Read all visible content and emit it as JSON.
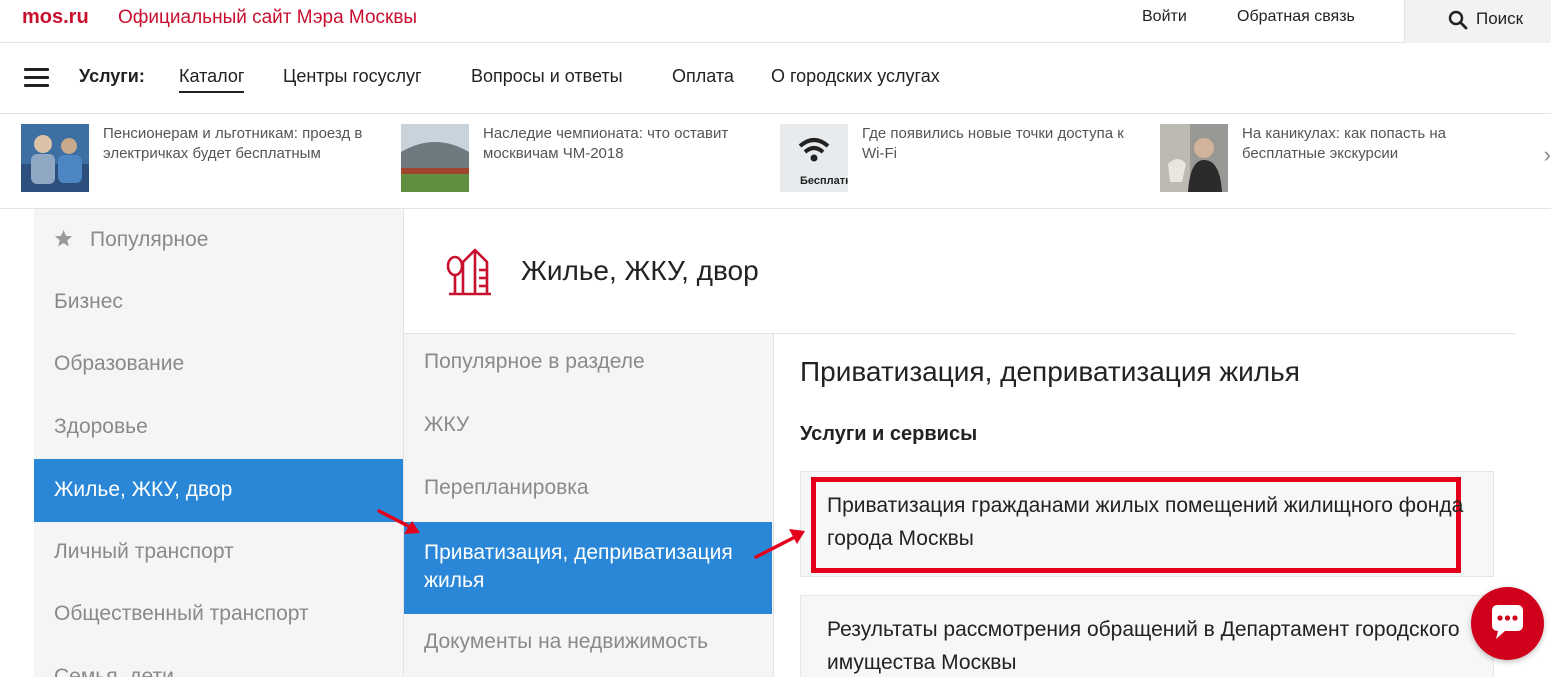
{
  "header": {
    "logo": "mos.ru",
    "site_title": "Официальный сайт Мэра Москвы",
    "login": "Войти",
    "feedback": "Обратная связь",
    "search_label": "Поиск"
  },
  "nav": {
    "label": "Услуги:",
    "items": [
      {
        "label": "Каталог",
        "active": true
      },
      {
        "label": "Центры госуслуг"
      },
      {
        "label": "Вопросы и ответы"
      },
      {
        "label": "Оплата"
      },
      {
        "label": "О городских услугах"
      }
    ]
  },
  "news": [
    {
      "text": "Пенсионерам и льготникам: проезд в электричках будет бесплатным"
    },
    {
      "text": "Наследие чемпионата: что оставит москвичам ЧМ-2018"
    },
    {
      "text": "Где появились новые точки доступа к Wi-Fi",
      "thumb_text": "Бесплатны"
    },
    {
      "text": "На каникулах: как попасть на бесплатные экскурсии"
    }
  ],
  "sidebar": {
    "items": [
      {
        "label": "Популярное",
        "icon": "star-icon"
      },
      {
        "label": "Бизнес"
      },
      {
        "label": "Образование"
      },
      {
        "label": "Здоровье"
      },
      {
        "label": "Жилье, ЖКУ, двор",
        "active": true
      },
      {
        "label": "Личный транспорт"
      },
      {
        "label": "Общественный транспорт"
      },
      {
        "label": "Семья, дети"
      }
    ]
  },
  "category": {
    "title": "Жилье, ЖКУ, двор",
    "icon": "housing-icon"
  },
  "subnav": {
    "items": [
      {
        "label": "Популярное в разделе"
      },
      {
        "label": "ЖКУ"
      },
      {
        "label": "Перепланировка"
      },
      {
        "label": "Приватизация, деприватизация жилья",
        "active": true
      },
      {
        "label": "Документы на недвижимость"
      }
    ]
  },
  "content": {
    "title": "Приватизация, деприватизация жилья",
    "subtitle": "Услуги и сервисы",
    "cards": [
      {
        "text": "Приватизация гражданами жилых помещений жилищного фонда города Москвы",
        "highlighted": true
      },
      {
        "text": "Результаты рассмотрения обращений в Департамент городского имущества Москвы"
      }
    ]
  },
  "colors": {
    "brand_red": "#c8102e",
    "active_blue": "#2a87d7",
    "highlight_red": "#e3001b"
  }
}
